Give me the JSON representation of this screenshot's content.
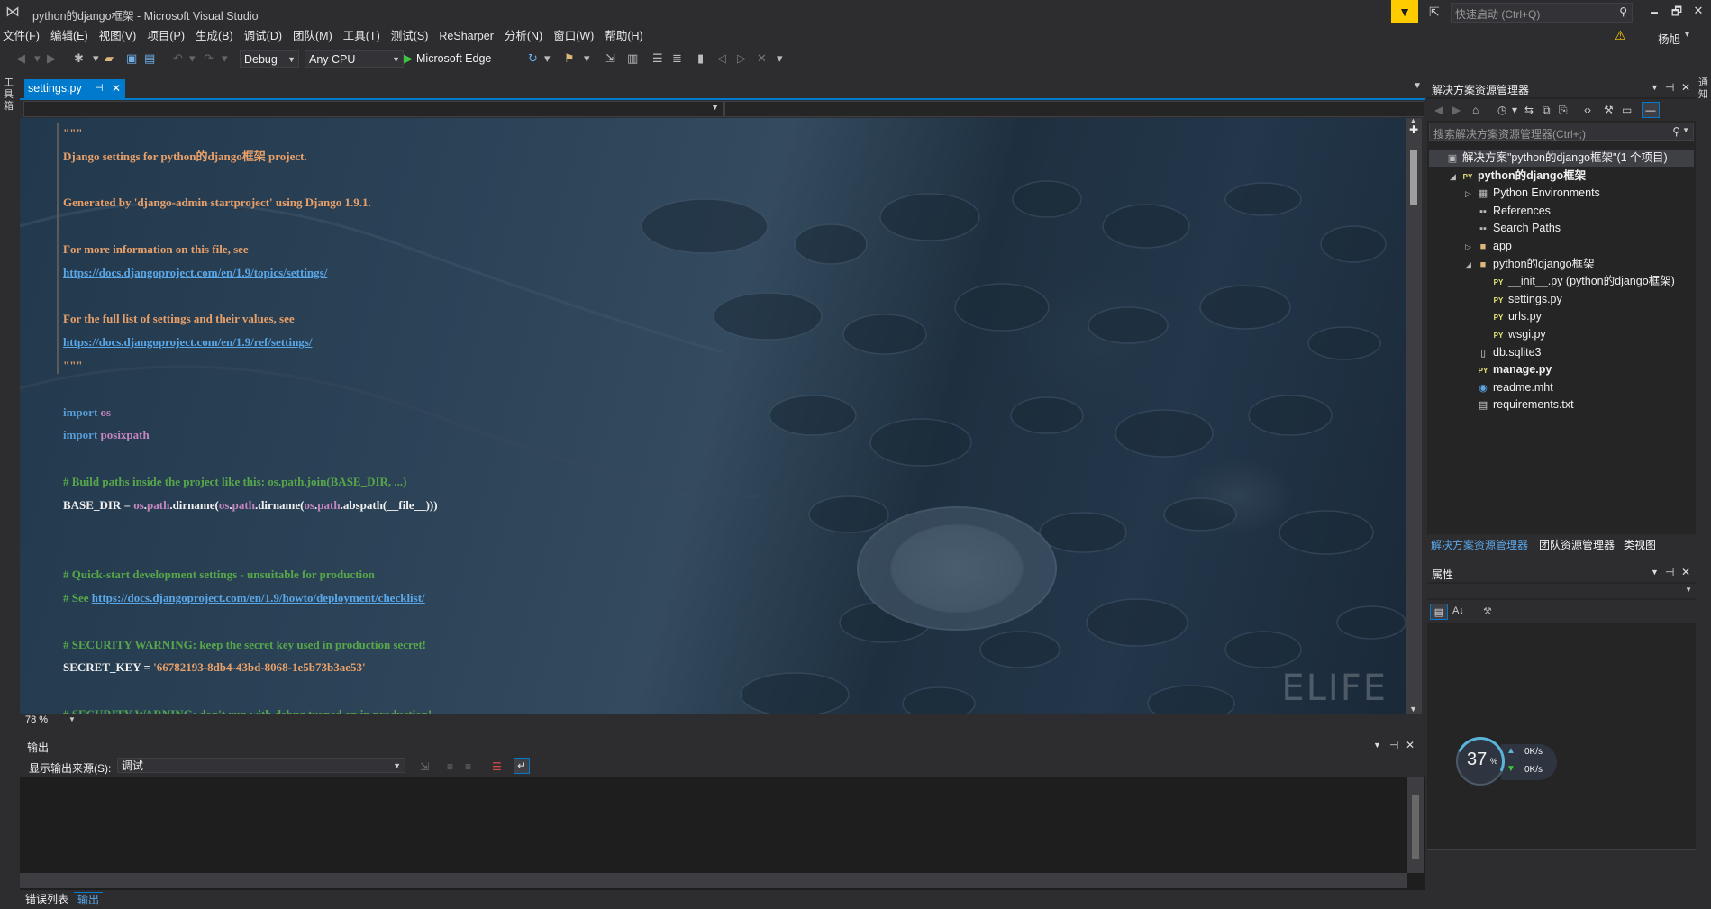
{
  "window": {
    "title": "python的django框架 - Microsoft Visual Studio",
    "quick_launch_placeholder": "快速启动 (Ctrl+Q)",
    "min": "🗕",
    "restore": "🗗",
    "close": "✕"
  },
  "menu": [
    "文件(F)",
    "编辑(E)",
    "视图(V)",
    "项目(P)",
    "生成(B)",
    "调试(D)",
    "团队(M)",
    "工具(T)",
    "测试(S)",
    "ReSharper",
    "分析(N)",
    "窗口(W)",
    "帮助(H)"
  ],
  "user": {
    "name": "杨旭",
    "warning": "⚠"
  },
  "toolbar": {
    "configuration": "Debug",
    "platform": "Any CPU",
    "run_target": "Microsoft Edge"
  },
  "side_strips": {
    "left": "工具箱",
    "right": "通知"
  },
  "tabs": {
    "active": "settings.py",
    "pin": "⊣",
    "close": "✕"
  },
  "editor": {
    "zoom": "78 %",
    "watermark": "ELIFE",
    "lines": [
      [
        {
          "t": "\"\"\"",
          "c": "doc"
        }
      ],
      [
        {
          "t": "Django settings for python的django框架 project.",
          "c": "doc"
        }
      ],
      [
        {
          "t": "",
          "c": "plain"
        }
      ],
      [
        {
          "t": "Generated by 'django-admin startproject' using Django 1.9.1.",
          "c": "doc"
        }
      ],
      [
        {
          "t": "",
          "c": "plain"
        }
      ],
      [
        {
          "t": "For more information on this file, see",
          "c": "doc"
        }
      ],
      [
        {
          "t": "https://docs.djangoproject.com/en/1.9/topics/settings/",
          "c": "lnk"
        }
      ],
      [
        {
          "t": "",
          "c": "plain"
        }
      ],
      [
        {
          "t": "For the full list of settings and their values, see",
          "c": "doc"
        }
      ],
      [
        {
          "t": "https://docs.djangoproject.com/en/1.9/ref/settings/",
          "c": "lnk"
        }
      ],
      [
        {
          "t": "\"\"\"",
          "c": "doc"
        }
      ],
      [
        {
          "t": "",
          "c": "plain"
        }
      ],
      [
        {
          "t": "import ",
          "c": "kw"
        },
        {
          "t": "os",
          "c": "mod"
        }
      ],
      [
        {
          "t": "import ",
          "c": "kw"
        },
        {
          "t": "posixpath",
          "c": "mod"
        }
      ],
      [
        {
          "t": "",
          "c": "plain"
        }
      ],
      [
        {
          "t": "# Build paths inside the project like this: os.path.join(BASE_DIR, ...)",
          "c": "cmt"
        }
      ],
      [
        {
          "t": "BASE_DIR = ",
          "c": "plain"
        },
        {
          "t": "os",
          "c": "mod"
        },
        {
          "t": ".",
          "c": "plain"
        },
        {
          "t": "path",
          "c": "mod"
        },
        {
          "t": ".dirname(",
          "c": "plain"
        },
        {
          "t": "os",
          "c": "mod"
        },
        {
          "t": ".",
          "c": "plain"
        },
        {
          "t": "path",
          "c": "mod"
        },
        {
          "t": ".dirname(",
          "c": "plain"
        },
        {
          "t": "os",
          "c": "mod"
        },
        {
          "t": ".",
          "c": "plain"
        },
        {
          "t": "path",
          "c": "mod"
        },
        {
          "t": ".abspath(__file__)))",
          "c": "plain"
        }
      ],
      [
        {
          "t": "",
          "c": "plain"
        }
      ],
      [
        {
          "t": "",
          "c": "plain"
        }
      ],
      [
        {
          "t": "# Quick-start development settings - unsuitable for production",
          "c": "cmt"
        }
      ],
      [
        {
          "t": "# See ",
          "c": "cmt"
        },
        {
          "t": "https://docs.djangoproject.com/en/1.9/howto/deployment/checklist/",
          "c": "lnk"
        }
      ],
      [
        {
          "t": "",
          "c": "plain"
        }
      ],
      [
        {
          "t": "# SECURITY WARNING: keep the secret key used in production secret!",
          "c": "cmt"
        }
      ],
      [
        {
          "t": "SECRET_KEY = ",
          "c": "plain"
        },
        {
          "t": "'66782193-8db4-43bd-8068-1e5b73b3ae53'",
          "c": "str"
        }
      ],
      [
        {
          "t": "",
          "c": "plain"
        }
      ],
      [
        {
          "t": "# SECURITY WARNING: don't run with debug turned on in production!",
          "c": "cmt"
        }
      ]
    ]
  },
  "output": {
    "title": "输出",
    "source_label": "显示输出来源(S):",
    "source_value": "调试"
  },
  "bottom_tabs": [
    "错误列表",
    "输出"
  ],
  "solution_explorer": {
    "title": "解决方案资源管理器",
    "search_placeholder": "搜索解决方案资源管理器(Ctrl+;)",
    "tree": [
      {
        "label": "解决方案\"python的django框架\"(1 个项目)",
        "depth": 0,
        "exp": "",
        "icon": "▣",
        "icon_color": "#bcbcbc",
        "bold": false,
        "selected": true
      },
      {
        "label": "python的django框架",
        "depth": 1,
        "exp": "◢",
        "icon": "PY",
        "icon_color": "#e8e87a",
        "bold": true
      },
      {
        "label": "Python Environments",
        "depth": 2,
        "exp": "▷",
        "icon": "▦",
        "icon_color": "#bcbcbc",
        "bold": false
      },
      {
        "label": "References",
        "depth": 2,
        "exp": "",
        "icon": "▪▪",
        "icon_color": "#bcbcbc",
        "bold": false
      },
      {
        "label": "Search Paths",
        "depth": 2,
        "exp": "",
        "icon": "▪▪",
        "icon_color": "#bcbcbc",
        "bold": false
      },
      {
        "label": "app",
        "depth": 2,
        "exp": "▷",
        "icon": "■",
        "icon_color": "#dcb67a",
        "bold": false
      },
      {
        "label": "python的django框架",
        "depth": 2,
        "exp": "◢",
        "icon": "■",
        "icon_color": "#dcb67a",
        "bold": false
      },
      {
        "label": "__init__.py (python的django框架)",
        "depth": 3,
        "exp": "",
        "icon": "PY",
        "icon_color": "#e8e87a",
        "bold": false
      },
      {
        "label": "settings.py",
        "depth": 3,
        "exp": "",
        "icon": "PY",
        "icon_color": "#e8e87a",
        "bold": false
      },
      {
        "label": "urls.py",
        "depth": 3,
        "exp": "",
        "icon": "PY",
        "icon_color": "#e8e87a",
        "bold": false
      },
      {
        "label": "wsgi.py",
        "depth": 3,
        "exp": "",
        "icon": "PY",
        "icon_color": "#e8e87a",
        "bold": false
      },
      {
        "label": "db.sqlite3",
        "depth": 2,
        "exp": "",
        "icon": "▯",
        "icon_color": "#dcdcdc",
        "bold": false
      },
      {
        "label": "manage.py",
        "depth": 2,
        "exp": "",
        "icon": "PY",
        "icon_color": "#e8e87a",
        "bold": true
      },
      {
        "label": "readme.mht",
        "depth": 2,
        "exp": "",
        "icon": "◉",
        "icon_color": "#5aa7e8",
        "bold": false
      },
      {
        "label": "requirements.txt",
        "depth": 2,
        "exp": "",
        "icon": "▤",
        "icon_color": "#dcdcdc",
        "bold": false
      }
    ],
    "bottom_tabs": [
      "解决方案资源管理器",
      "团队资源管理器",
      "类视图"
    ]
  },
  "properties": {
    "title": "属性"
  },
  "net_widget": {
    "percent": "37",
    "percent_sign": "%",
    "up": "0K/s",
    "down": "0K/s",
    "accent": "#5ab4d8"
  }
}
